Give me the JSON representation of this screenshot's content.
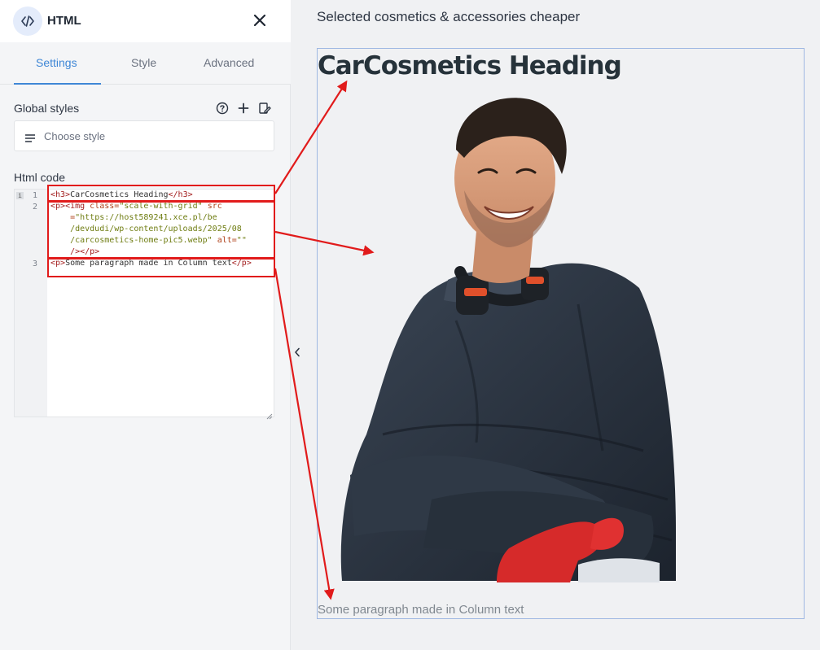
{
  "sidebar": {
    "title": "HTML",
    "header_icon": "code-icon",
    "tabs": [
      {
        "label": "Settings",
        "active": true
      },
      {
        "label": "Style",
        "active": false
      },
      {
        "label": "Advanced",
        "active": false
      }
    ],
    "global_styles": {
      "label": "Global styles",
      "select_placeholder": "Choose style"
    },
    "html_code": {
      "label": "Html code",
      "line_numbers": [
        "1",
        "2",
        "3"
      ],
      "info_marker": "i",
      "line1": {
        "open": "<h3>",
        "text": "CarCosmetics Heading",
        "close": "</h3>"
      },
      "line2": {
        "p_open": "<p>",
        "img_open": "<img",
        "class_attr": " class=",
        "class_val": "\"scale-with-grid\"",
        "src_attr": " src",
        "src_eq": "    =",
        "src_val1": "\"https://host589241.xce.pl/be",
        "src_val2": "    /devdudi/wp-content/uploads/2025/08",
        "src_val3": "    /carcosmetics-home-pic5.webp\"",
        "alt_attr": " alt=",
        "alt_val": "\"\"",
        "img_close": "    />",
        "p_close": "</p>"
      },
      "line3": {
        "open": "<p>",
        "text": "Some paragraph made in Column text",
        "close": "</p>"
      }
    }
  },
  "canvas": {
    "top_text": "Selected cosmetics & accessories cheaper",
    "heading": "CarCosmetics Heading",
    "paragraph": "Some paragraph made in Column text",
    "image_subject": "smiling man in dark jacket with arms crossed"
  },
  "colors": {
    "accent": "#3f87d6",
    "annotation_red": "#e11b1b",
    "preview_border": "#9fb8e2"
  }
}
